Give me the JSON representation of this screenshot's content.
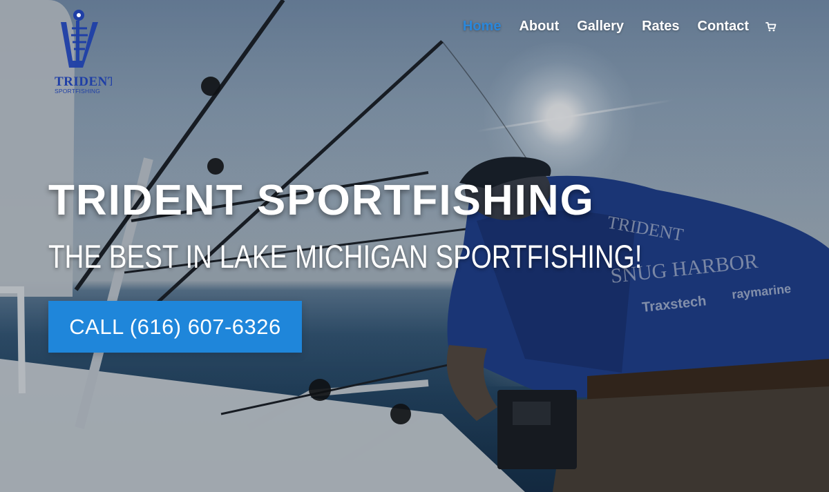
{
  "logo": {
    "brand": "TRIDENT",
    "tagline": "SPORTFISHING"
  },
  "nav": {
    "items": [
      {
        "label": "Home",
        "active": true
      },
      {
        "label": "About",
        "active": false
      },
      {
        "label": "Gallery",
        "active": false
      },
      {
        "label": "Rates",
        "active": false
      },
      {
        "label": "Contact",
        "active": false
      }
    ],
    "cart_icon": "shopping-cart-icon"
  },
  "hero": {
    "title": "TRIDENT SPORTFISHING",
    "subtitle": "THE BEST IN LAKE MICHIGAN SPORTFISHING!",
    "cta_label": "CALL (616) 607-6326"
  },
  "colors": {
    "accent": "#2b87da",
    "button": "#1f86da"
  }
}
